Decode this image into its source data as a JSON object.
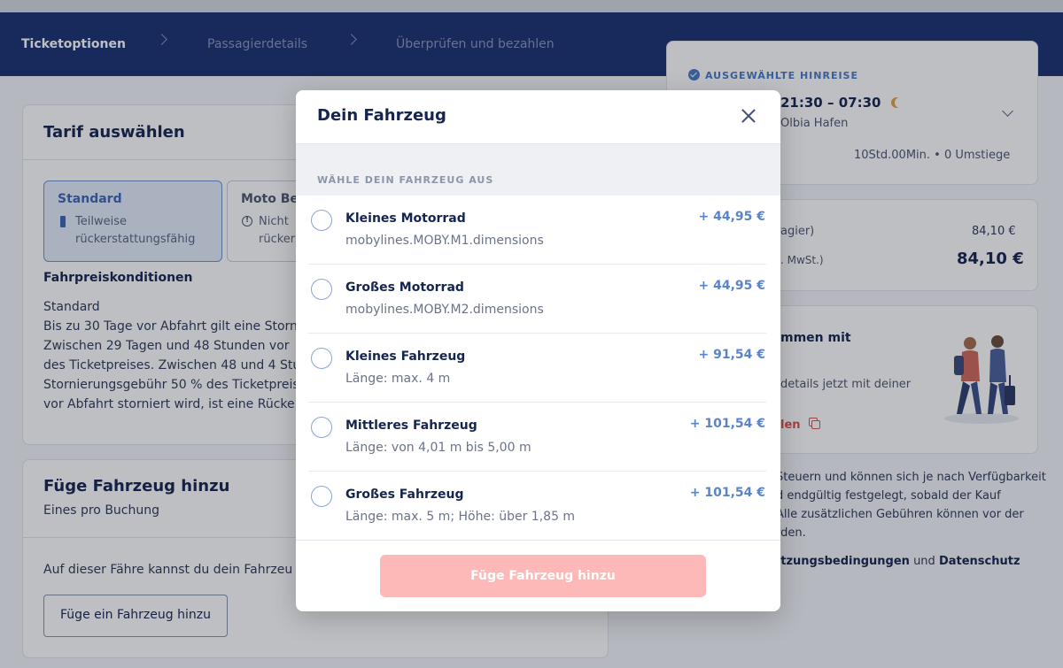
{
  "nav": {
    "steps": [
      {
        "label": "Ticketoptionen"
      },
      {
        "label": "Passagierdetails"
      },
      {
        "label": "Überprüfen und bezahlen"
      }
    ]
  },
  "tariff_card": {
    "title": "Tarif auswählen",
    "options": [
      {
        "name": "Standard",
        "sub": "Teilweise rückerstattungsfähig"
      },
      {
        "name": "Moto Be",
        "sub": "Nicht rückers"
      }
    ],
    "conditions_title": "Fahrpreiskonditionen",
    "conditions_lines": [
      "Standard",
      "Bis zu 30 Tage vor Abfahrt gilt eine Storn",
      "Zwischen 29 Tagen und 48 Stunden vor ",
      "des Ticketpreises. Zwischen 48 und 4 Stu",
      "Stornierungsgebühr 50 % des Ticketpreis",
      "vor Abfahrt storniert wird, ist eine Rücke"
    ]
  },
  "vehicle_card": {
    "title": "Füge Fahrzeug hinzu",
    "subtitle": "Eines pro Buchung",
    "text": "Auf dieser Fähre kannst du dein Fahrzeu",
    "button": "Füge ein Fahrzeug hinzu"
  },
  "trip_card": {
    "label": "AUSGEWÄHLTE HINREISE",
    "time": "21:30 – 07:30",
    "destination": "Olbia Hafen",
    "duration": "10Std.00Min. • 0 Umstiege"
  },
  "price_card": {
    "line1_label": "agier)",
    "line1_value": "84,10 €",
    "line2_label": ". MwSt.)",
    "total": "84,10 €"
  },
  "promo_card": {
    "title": "mmen mit",
    "text": "details jetzt mit deiner",
    "link": "len"
  },
  "disclaimer": {
    "lines": [
      "Steuern und können sich je nach Verfügbarkeit",
      "d endgültig festgelegt, sobald der Kauf",
      "Alle zusätzlichen Gebühren können vor der",
      "rden."
    ],
    "terms_link": "utzungsbedingungen",
    "and": "und",
    "privacy_link": "Datenschutz"
  },
  "modal": {
    "title": "Dein Fahrzeug",
    "section_label": "WÄHLE DEIN FAHRZEUG AUS",
    "options": [
      {
        "name": "Kleines Motorrad",
        "desc": "mobylines.MOBY.M1.dimensions",
        "price": "+ 44,95 €"
      },
      {
        "name": "Großes Motorrad",
        "desc": "mobylines.MOBY.M2.dimensions",
        "price": "+ 44,95 €"
      },
      {
        "name": "Kleines Fahrzeug",
        "desc": "Länge: max. 4 m",
        "price": "+ 91,54 €"
      },
      {
        "name": "Mittleres Fahrzeug",
        "desc": "Länge: von 4,01 m bis 5,00 m",
        "price": "+ 101,54 €"
      },
      {
        "name": "Großes Fahrzeug",
        "desc": "Länge: max. 5 m; Höhe: über 1,85 m",
        "price": "+ 101,54 €"
      }
    ],
    "cta": "Füge Fahrzeug hinzu"
  },
  "colors": {
    "nav_bg": "#1b3070",
    "accent": "#4a79c7",
    "cta_disabled": "#fdb8b8"
  }
}
